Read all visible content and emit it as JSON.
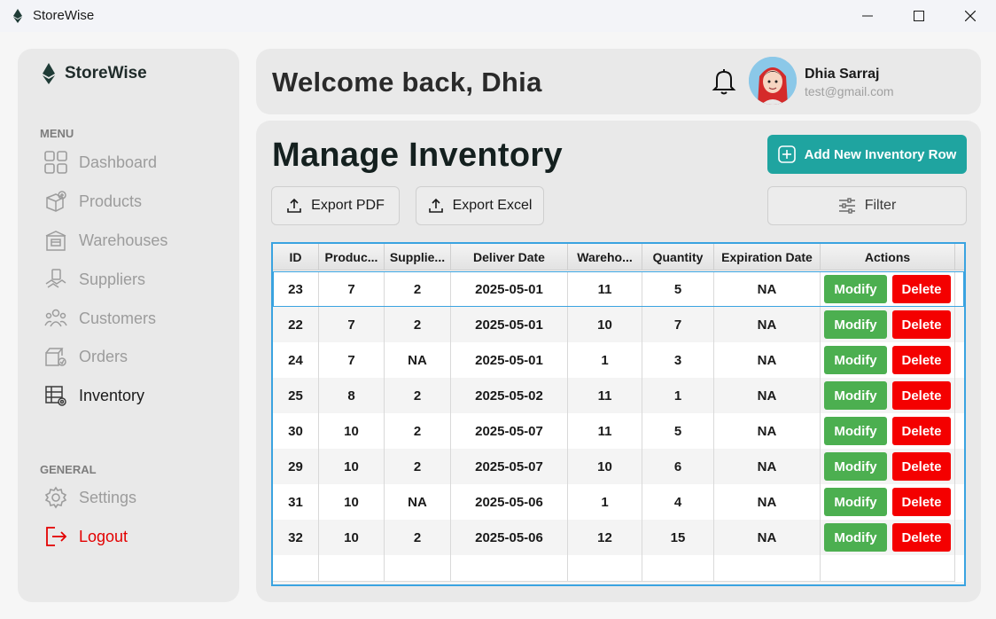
{
  "window": {
    "title": "StoreWise"
  },
  "sidebar": {
    "brand": "StoreWise",
    "menu_label": "MENU",
    "items": [
      {
        "label": "Dashboard",
        "icon": "dashboard-icon"
      },
      {
        "label": "Products",
        "icon": "products-icon"
      },
      {
        "label": "Warehouses",
        "icon": "warehouses-icon"
      },
      {
        "label": "Suppliers",
        "icon": "suppliers-icon"
      },
      {
        "label": "Customers",
        "icon": "customers-icon"
      },
      {
        "label": "Orders",
        "icon": "orders-icon"
      },
      {
        "label": "Inventory",
        "icon": "inventory-icon",
        "active": true
      }
    ],
    "general_label": "GENERAL",
    "general_items": [
      {
        "label": "Settings",
        "icon": "settings-icon"
      },
      {
        "label": "Logout",
        "icon": "logout-icon"
      }
    ]
  },
  "header": {
    "welcome": "Welcome back, Dhia",
    "user_name": "Dhia Sarraj",
    "user_email": "test@gmail.com"
  },
  "main": {
    "title": "Manage Inventory",
    "add_button": "Add New Inventory Row",
    "export_pdf": "Export PDF",
    "export_excel": "Export Excel",
    "filter": "Filter"
  },
  "table": {
    "columns": [
      "ID",
      "Produc...",
      "Supplie...",
      "Deliver Date",
      "Wareho...",
      "Quantity",
      "Expiration Date",
      "Actions"
    ],
    "rows": [
      [
        "23",
        "7",
        "2",
        "2025-05-01",
        "11",
        "5",
        "NA"
      ],
      [
        "22",
        "7",
        "2",
        "2025-05-01",
        "10",
        "7",
        "NA"
      ],
      [
        "24",
        "7",
        "NA",
        "2025-05-01",
        "1",
        "3",
        "NA"
      ],
      [
        "25",
        "8",
        "2",
        "2025-05-02",
        "11",
        "1",
        "NA"
      ],
      [
        "30",
        "10",
        "2",
        "2025-05-07",
        "11",
        "5",
        "NA"
      ],
      [
        "29",
        "10",
        "2",
        "2025-05-07",
        "10",
        "6",
        "NA"
      ],
      [
        "31",
        "10",
        "NA",
        "2025-05-06",
        "1",
        "4",
        "NA"
      ],
      [
        "32",
        "10",
        "2",
        "2025-05-06",
        "12",
        "15",
        "NA"
      ]
    ],
    "modify_label": "Modify",
    "delete_label": "Delete",
    "selected_row": 0
  },
  "colors": {
    "accent": "#1fa4a0",
    "modify": "#4caf50",
    "delete": "#f40000",
    "logout": "#e30000",
    "selection": "#3aa3e0"
  }
}
